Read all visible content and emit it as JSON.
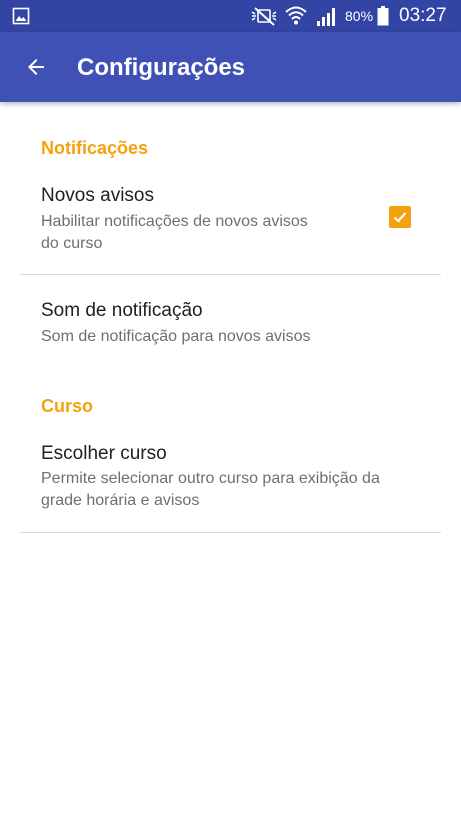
{
  "status_bar": {
    "battery_percent": "80%",
    "time": "03:27",
    "icons": [
      "gallery-icon",
      "mute-icon",
      "wifi-icon",
      "signal-icon",
      "battery-icon"
    ]
  },
  "app_bar": {
    "back_icon": "arrow-back-icon",
    "title": "Configurações",
    "color": "#3f51b5"
  },
  "sections": {
    "notifications": {
      "header": "Notificações",
      "new_notices": {
        "title": "Novos avisos",
        "summary_line1": "Habilitar notificações de novos avisos",
        "summary_line2": "do curso",
        "checked": true
      },
      "notification_sound": {
        "title": "Som de notificação",
        "summary": "Som de notificação para novos avisos"
      }
    },
    "course": {
      "header": "Curso",
      "choose_course": {
        "title": "Escolher curso",
        "summary_line1": "Permite selecionar outro curso para exibição da",
        "summary_line2": "grade horária e avisos"
      }
    }
  },
  "colors": {
    "accent": "#f5a00f",
    "primary": "#3f51b5",
    "primary_dark": "#3245a5"
  }
}
